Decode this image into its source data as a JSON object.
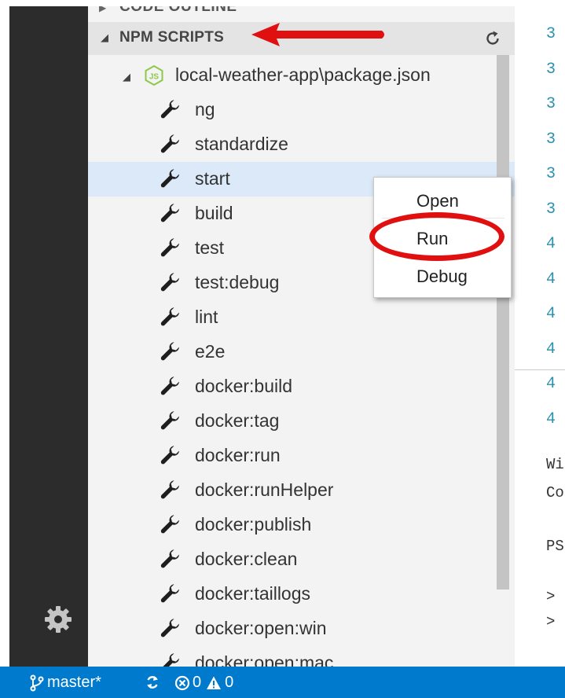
{
  "colors": {
    "activitybar": "#2c2c2c",
    "sidebar": "#f3f3f3",
    "section_header": "#e4e4e4",
    "selection": "#dbe9f8",
    "statusbar": "#007acc",
    "annotation_red": "#e01010",
    "npm_green": "#8cc84b",
    "line_number": "#2b91af"
  },
  "sidebar": {
    "outline_header": "CODE OUTLINE",
    "npm_header": "NPM SCRIPTS",
    "refresh_icon": "refresh-icon",
    "package": {
      "label": "local-weather-app\\package.json",
      "icon": "node-js-icon"
    },
    "scripts": [
      {
        "label": "ng"
      },
      {
        "label": "standardize"
      },
      {
        "label": "start",
        "selected": true
      },
      {
        "label": "build"
      },
      {
        "label": "test"
      },
      {
        "label": "test:debug"
      },
      {
        "label": "lint"
      },
      {
        "label": "e2e"
      },
      {
        "label": "docker:build"
      },
      {
        "label": "docker:tag"
      },
      {
        "label": "docker:run"
      },
      {
        "label": "docker:runHelper"
      },
      {
        "label": "docker:publish"
      },
      {
        "label": "docker:clean"
      },
      {
        "label": "docker:taillogs"
      },
      {
        "label": "docker:open:win"
      },
      {
        "label": "docker:open:mac"
      }
    ]
  },
  "context_menu": {
    "items": [
      "Open",
      "Run",
      "Debug"
    ],
    "highlighted": "Run"
  },
  "editor": {
    "line_numbers": [
      "3",
      "3",
      "3",
      "3",
      "3",
      "3",
      "4",
      "4",
      "4",
      "4",
      "4",
      "4"
    ],
    "terminal_lines": [
      "Wi",
      "Co",
      "",
      "PS",
      "",
      ">",
      ">"
    ]
  },
  "statusbar": {
    "branch": "master*",
    "errors": "0",
    "warnings": "0"
  }
}
